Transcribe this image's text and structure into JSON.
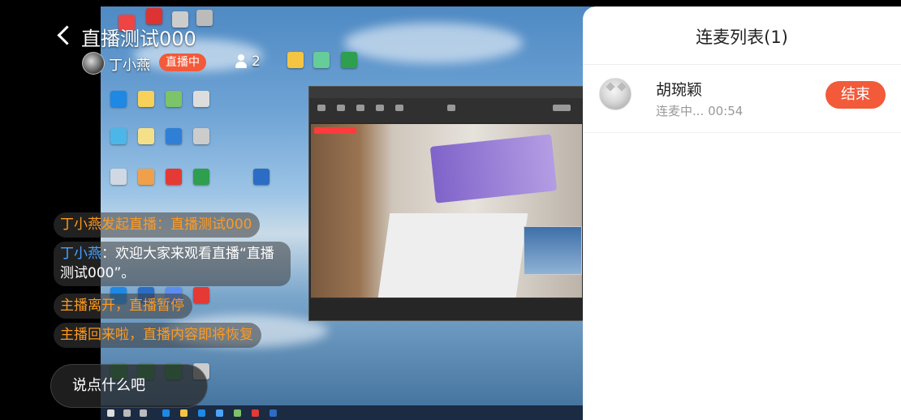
{
  "header": {
    "room_title": "直播测试000",
    "host_name": "丁小燕",
    "live_badge": "直播中",
    "viewer_count": "2"
  },
  "chat": {
    "messages": [
      {
        "type": "system",
        "text": "丁小燕发起直播：直播测试000"
      },
      {
        "type": "user",
        "user": "丁小燕",
        "separator": "：",
        "text": "欢迎大家来观看直播“直播测试000”。"
      },
      {
        "type": "system",
        "text": "主播离开，直播暂停"
      },
      {
        "type": "system",
        "text": "主播回来啦，直播内容即将恢复"
      }
    ],
    "input_placeholder": "说点什么吧"
  },
  "panel": {
    "title": "连麦列表(1)",
    "items": [
      {
        "name": "胡琬颖",
        "status": "连麦中... 00:54",
        "action": "结束"
      }
    ]
  },
  "colors": {
    "accent": "#f25a3a",
    "system_message": "#ff9a1f",
    "username": "#4aa3ff"
  },
  "icons": [
    "back-arrow-icon",
    "viewer-icon"
  ]
}
